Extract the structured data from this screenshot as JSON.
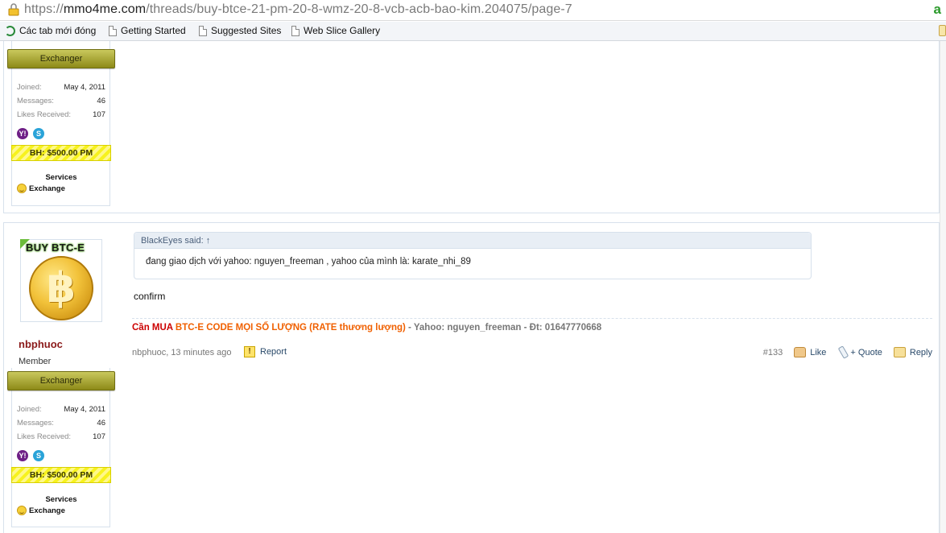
{
  "browser": {
    "url_prefix": "https://",
    "url_host": "mmo4me.com",
    "url_path": "/threads/buy-btce-21-pm-20-8-wmz-20-8-vcb-acb-bao-kim.204075/page-7",
    "ext_icon": "a"
  },
  "bookmarks": [
    {
      "label": "Các tab mới đóng",
      "icon": "undo-icon"
    },
    {
      "label": "Getting Started",
      "icon": "page-icon"
    },
    {
      "label": "Suggested Sites",
      "icon": "page-icon"
    },
    {
      "label": "Web Slice Gallery",
      "icon": "page-icon"
    }
  ],
  "post1": {
    "ribbon": "Exchanger",
    "joined_label": "Joined:",
    "joined": "May 4, 2011",
    "messages_label": "Messages:",
    "messages": "46",
    "likes_label": "Likes Received:",
    "likes": "107",
    "bh": "BH: $500.00 PM",
    "services": "Services",
    "exchange": "Exchange"
  },
  "post2": {
    "avatar_text": "BUY BTC-E",
    "coin_symbol": "฿",
    "username": "nbphuoc",
    "user_title": "Member",
    "ribbon": "Exchanger",
    "joined_label": "Joined:",
    "joined": "May 4, 2011",
    "messages_label": "Messages:",
    "messages": "46",
    "likes_label": "Likes Received:",
    "likes": "107",
    "bh": "BH: $500.00 PM",
    "services": "Services",
    "exchange": "Exchange",
    "quote_header": "BlackEyes said: ↑",
    "quote_body": "đang giao dịch với yahoo: nguyen_freeman , yahoo của mình là: karate_nhi_89",
    "message": "confirm",
    "sig_red": "Cần MUA",
    "sig_orange": "BTC-E CODE MỌI SỐ LƯỢNG (RATE thương lượng)",
    "sig_grey": "- Yahoo: nguyen_freeman - Đt: 01647770668",
    "meta": "nbphuoc, 13 minutes ago",
    "report": "Report",
    "post_number": "#133",
    "like": "Like",
    "quote": "+ Quote",
    "reply": "Reply"
  },
  "colors": {
    "username": "#8b1a1a",
    "sig_red": "#cc0000",
    "sig_orange": "#f06000",
    "ribbon": "#8d8a18",
    "bh_stripe": "#f7f21e"
  }
}
